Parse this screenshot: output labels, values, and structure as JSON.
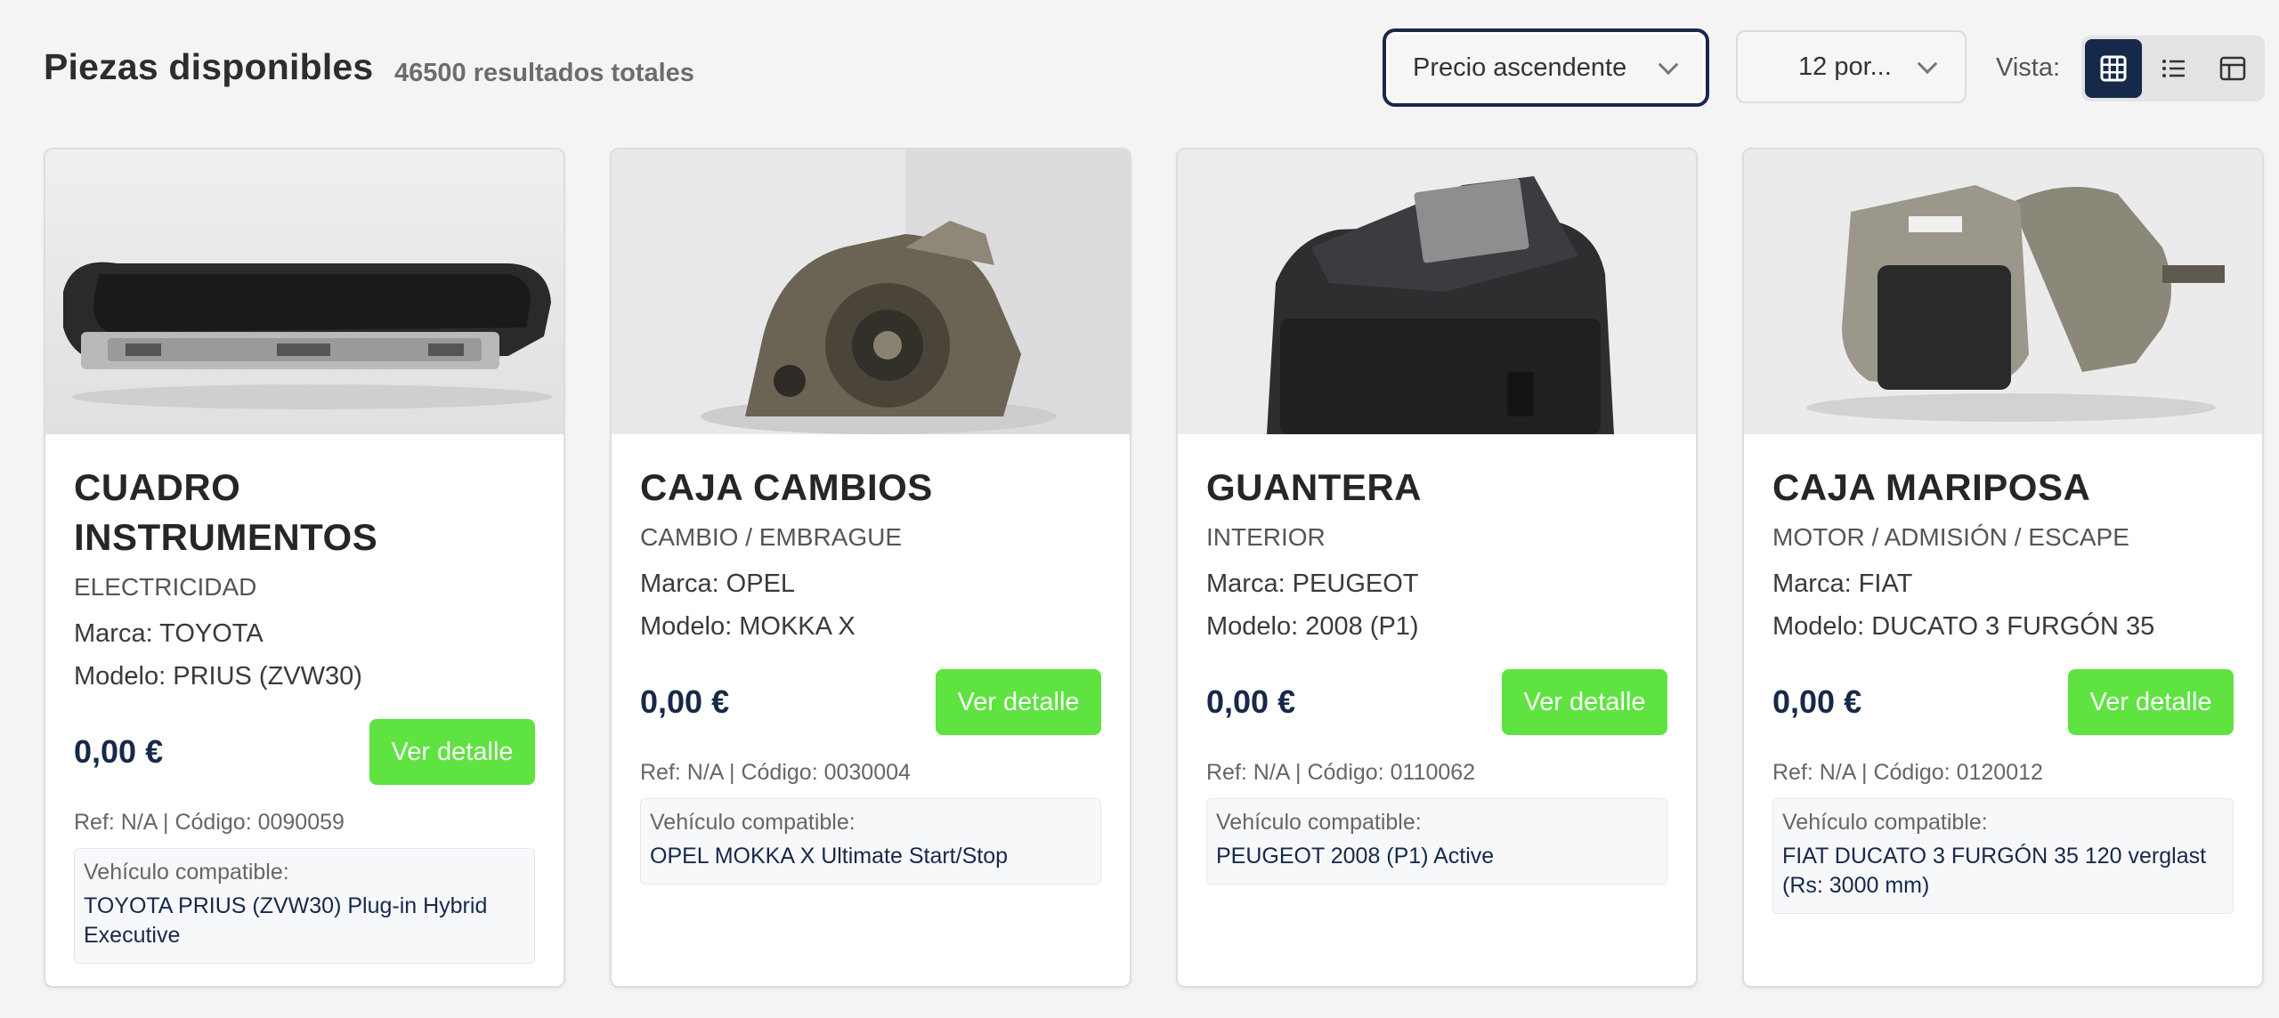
{
  "header": {
    "title": "Piezas disponibles",
    "result_count": "46500 resultados totales",
    "sort_select": {
      "value": "Precio ascendente"
    },
    "per_page_select": {
      "value": "12 por..."
    },
    "view_label": "Vista:",
    "view_modes": [
      "grid-icon",
      "list-icon",
      "table-icon"
    ],
    "active_view": "grid"
  },
  "colors": {
    "accent_navy": "#17294a",
    "button_green": "#5ee341",
    "background": "#f4f4f4"
  },
  "cards": [
    {
      "title": "CUADRO INSTRUMENTOS",
      "category": "ELECTRICIDAD",
      "brand": "Marca: TOYOTA",
      "model": "Modelo: PRIUS (ZVW30)",
      "price": "0,00 €",
      "button": "Ver detalle",
      "ref": "Ref: N/A | Código: 0090059",
      "compat_label": "Vehículo compatible:",
      "compat_value": "TOYOTA PRIUS (ZVW30) Plug-in Hybrid Executive",
      "image": "instrument-cluster-photo"
    },
    {
      "title": "CAJA CAMBIOS",
      "category": "CAMBIO / EMBRAGUE",
      "brand": "Marca: OPEL",
      "model": "Modelo: MOKKA X",
      "price": "0,00 €",
      "button": "Ver detalle",
      "ref": "Ref: N/A | Código: 0030004",
      "compat_label": "Vehículo compatible:",
      "compat_value": "OPEL MOKKA X Ultimate Start/Stop",
      "image": "gearbox-photo"
    },
    {
      "title": "GUANTERA",
      "category": "INTERIOR",
      "brand": "Marca: PEUGEOT",
      "model": "Modelo: 2008 (P1)",
      "price": "0,00 €",
      "button": "Ver detalle",
      "ref": "Ref: N/A | Código: 0110062",
      "compat_label": "Vehículo compatible:",
      "compat_value": "PEUGEOT 2008 (P1) Active",
      "image": "glovebox-photo"
    },
    {
      "title": "CAJA MARIPOSA",
      "category": "MOTOR / ADMISIÓN / ESCAPE",
      "brand": "Marca: FIAT",
      "model": "Modelo: DUCATO 3 FURGÓN 35",
      "price": "0,00 €",
      "button": "Ver detalle",
      "ref": "Ref: N/A | Código: 0120012",
      "compat_label": "Vehículo compatible:",
      "compat_value": "FIAT DUCATO 3 FURGÓN 35 120 verglast (Rs: 3000 mm)",
      "image": "throttle-body-photo"
    }
  ]
}
